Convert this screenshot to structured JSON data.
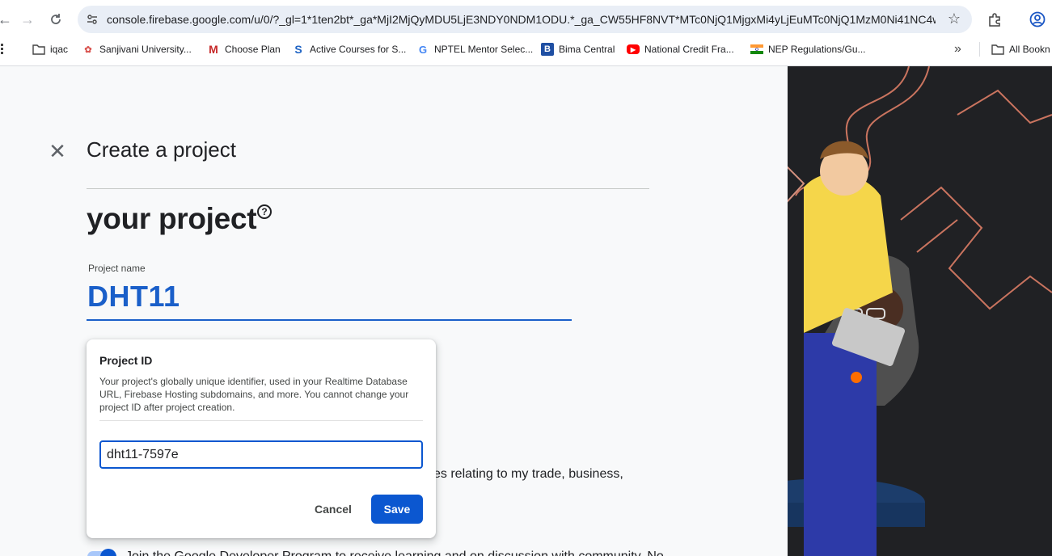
{
  "browser": {
    "url": "console.firebase.google.com/u/0/?_gl=1*1ten2bt*_ga*MjI2MjQyMDU5LjE3NDY0NDM1ODU.*_ga_CW55HF8NVT*MTc0NjQ1MjgxMi4yLjEuMTc0NjQ1MzM0Ni41NC4w...",
    "bookmarks": [
      {
        "label": "iqac",
        "icon": "folder-icon"
      },
      {
        "label": "Sanjivani University...",
        "icon": "sanjivani-icon"
      },
      {
        "label": "Choose Plan",
        "icon": "m-logo-icon"
      },
      {
        "label": "Active Courses for S...",
        "icon": "s-logo-icon"
      },
      {
        "label": "NPTEL Mentor Selec...",
        "icon": "google-icon"
      },
      {
        "label": "Bima Central",
        "icon": "b-logo-icon"
      },
      {
        "label": "National Credit Fra...",
        "icon": "youtube-icon"
      },
      {
        "label": "NEP Regulations/Gu...",
        "icon": "india-flag-icon"
      }
    ],
    "all_bookmarks_label": "All Bookn"
  },
  "page": {
    "title": "Create a project",
    "section_heading": "your project",
    "project_name_label": "Project name",
    "project_name_value": "DHT11",
    "terms_text": "es relating to my trade, business,",
    "bottom_text": "Join the Google Developer Program to receive learning and on discussion with community. No"
  },
  "popup": {
    "title": "Project ID",
    "description": "Your project's globally unique identifier, used in your Realtime Database URL, Firebase Hosting subdomains, and more. You cannot change your project ID after project creation.",
    "project_id_value": "dht11-7597e",
    "cancel_label": "Cancel",
    "save_label": "Save"
  },
  "colors": {
    "accent": "#0b57d0",
    "name_text": "#1a5fc9",
    "hero_bg": "#202124",
    "hero_lines": "#e8836a"
  }
}
